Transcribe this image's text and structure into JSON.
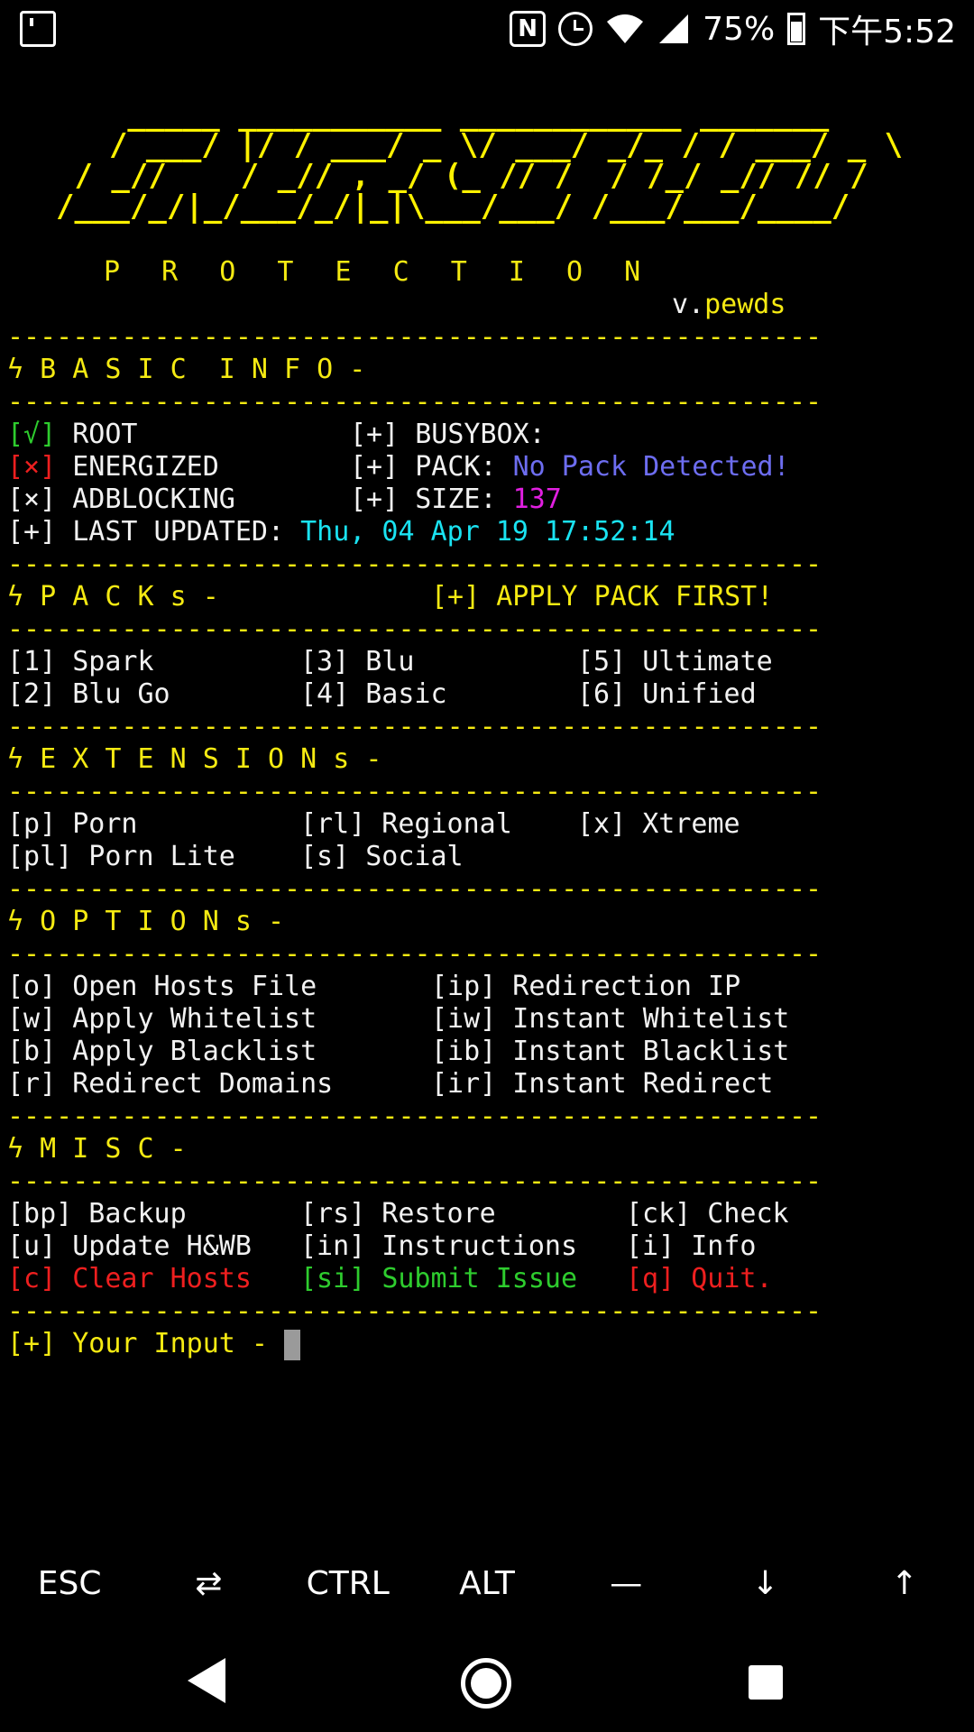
{
  "statusbar": {
    "battery_percent": "75%",
    "time": "下午5:52",
    "nfc_label": "N"
  },
  "banner": {
    "art_lines": [
      "   _____ ___________ ____________ _______",
      "  / ___/ |/ / ___/ _ \\/ ___/ _/_ / / ___/ _ \\",
      " / _//    / _// , _/ (_ // /  / /_/ _// // /",
      "/___/_/|_/___/_/|_|\\___/___/ /___/___/____/"
    ],
    "subtitle": "P R O T E C T I O N",
    "version_prefix": "v.",
    "version_name": "pewds"
  },
  "separator": "--------------------------------------------------",
  "bolt": "ϟ",
  "basic_info": {
    "heading": "B A S I C  I N F O -",
    "root_mark": "[√]",
    "root_label": "ROOT",
    "energized_mark": "[×]",
    "energized_label": "ENERGIZED",
    "adblock_mark": "[×]",
    "adblock_label": "ADBLOCKING",
    "busybox_label": "[+] BUSYBOX:",
    "pack_label": "[+] PACK:",
    "pack_value": "No Pack Detected!",
    "size_label": "[+] SIZE:",
    "size_value": "137",
    "updated_label": "[+] LAST UPDATED:",
    "updated_value": "Thu, 04 Apr 19 17:52:14"
  },
  "packs": {
    "heading": "P A C K s -",
    "hint": "[+] APPLY PACK FIRST!",
    "items": [
      "[1] Spark",
      "[3] Blu",
      "[5] Ultimate",
      "[2] Blu Go",
      "[4] Basic",
      "[6] Unified"
    ]
  },
  "extensions": {
    "heading": "E X T E N S I O N s -",
    "items": [
      "[p] Porn",
      "[rl] Regional",
      "[x] Xtreme",
      "[pl] Porn Lite",
      "[s] Social"
    ]
  },
  "options": {
    "heading": "O P T I O N s -",
    "items": [
      "[o] Open Hosts File",
      "[ip] Redirection IP",
      "[w] Apply Whitelist",
      "[iw] Instant Whitelist",
      "[b] Apply Blacklist",
      "[ib] Instant Blacklist",
      "[r] Redirect Domains",
      "[ir] Instant Redirect"
    ]
  },
  "misc": {
    "heading": "M I S C -",
    "items": [
      "[bp] Backup",
      "[rs] Restore",
      "[ck] Check",
      "[u] Update H&WB",
      "[in] Instructions",
      "[i] Info"
    ],
    "clear_key": "[c]",
    "clear_label": "Clear Hosts",
    "submit_key": "[si]",
    "submit_label": "Submit Issue",
    "quit_key": "[q]",
    "quit_label": "Quit."
  },
  "prompt": {
    "label": "[+] Your Input - "
  },
  "extrakeys": [
    "ESC",
    "⇄",
    "CTRL",
    "ALT",
    "—",
    "↓",
    "↑"
  ],
  "colors": {
    "yellow": "#f5ea12",
    "green": "#2ecc2e",
    "red": "#ee1f1f",
    "blue": "#6d6df0",
    "cyan": "#1ae3f2",
    "magenta": "#e11fe0"
  }
}
